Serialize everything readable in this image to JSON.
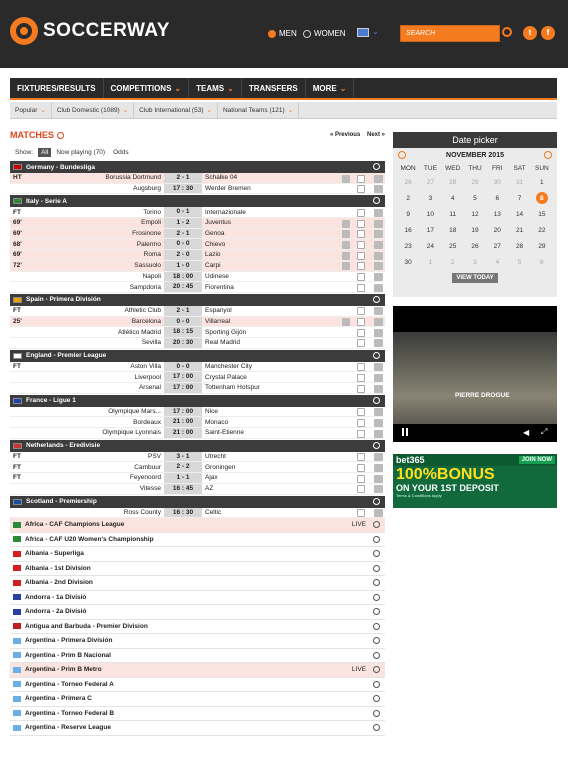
{
  "header": {
    "logo_text": "SOCCERWAY",
    "gender_men": "MEN",
    "gender_women": "WOMEN",
    "search_placeholder": "SEARCH",
    "social": [
      "t",
      "f"
    ]
  },
  "nav": {
    "items": [
      "FIXTURES/RESULTS",
      "COMPETITIONS",
      "TEAMS",
      "TRANSFERS",
      "MORE"
    ]
  },
  "subnav": {
    "items": [
      "Popular",
      "Club Domestic (1089)",
      "Club International (53)",
      "National Teams (121)"
    ]
  },
  "matches": {
    "title": "MATCHES",
    "prev": "« Previous",
    "next": "Next »",
    "show_label": "Show:",
    "filter_all": "All",
    "filter_live": "Now playing (70)",
    "filter_odds": "Odds"
  },
  "competitions": [
    {
      "name": "Germany - Bundesliga",
      "flag_color": "#c00",
      "rows": [
        {
          "status": "HT",
          "home": "Borussia Dortmund",
          "score": "2 - 1",
          "away": "Schalke 04",
          "live": true
        },
        {
          "status": "",
          "home": "Augsburg",
          "score": "17 : 30",
          "away": "Werder Bremen",
          "live": false
        }
      ]
    },
    {
      "name": "Italy - Serie A",
      "flag_color": "#2a8a3a",
      "rows": [
        {
          "status": "FT",
          "home": "Torino",
          "score": "0 - 1",
          "away": "Internazionale",
          "live": false
        },
        {
          "status": "69'",
          "home": "Empoli",
          "score": "1 - 2",
          "away": "Juventus",
          "live": true
        },
        {
          "status": "69'",
          "home": "Frosinone",
          "score": "2 - 1",
          "away": "Genoa",
          "live": true
        },
        {
          "status": "68'",
          "home": "Palermo",
          "score": "0 - 0",
          "away": "Chievo",
          "live": true
        },
        {
          "status": "69'",
          "home": "Roma",
          "score": "2 - 0",
          "away": "Lazio",
          "live": true
        },
        {
          "status": "72'",
          "home": "Sassuolo",
          "score": "1 - 0",
          "away": "Carpi",
          "live": true
        },
        {
          "status": "",
          "home": "Napoli",
          "score": "18 : 00",
          "away": "Udinese",
          "live": false
        },
        {
          "status": "",
          "home": "Sampdoria",
          "score": "20 : 45",
          "away": "Fiorentina",
          "live": false
        }
      ]
    },
    {
      "name": "Spain - Primera División",
      "flag_color": "#e8a000",
      "rows": [
        {
          "status": "FT",
          "home": "Athletic Club",
          "score": "2 - 1",
          "away": "Espanyol",
          "live": false
        },
        {
          "status": "25'",
          "home": "Barcelona",
          "score": "0 - 0",
          "away": "Villarreal",
          "live": true
        },
        {
          "status": "",
          "home": "Atlético Madrid",
          "score": "18 : 15",
          "away": "Sporting Gijón",
          "live": false
        },
        {
          "status": "",
          "home": "Sevilla",
          "score": "20 : 30",
          "away": "Real Madrid",
          "live": false
        }
      ]
    },
    {
      "name": "England - Premier League",
      "flag_color": "#fff",
      "rows": [
        {
          "status": "FT",
          "home": "Aston Villa",
          "score": "0 - 0",
          "away": "Manchester City",
          "live": false
        },
        {
          "status": "",
          "home": "Liverpool",
          "score": "17 : 00",
          "away": "Crystal Palace",
          "live": false
        },
        {
          "status": "",
          "home": "Arsenal",
          "score": "17 : 00",
          "away": "Tottenham Hotspur",
          "live": false
        }
      ]
    },
    {
      "name": "France - Ligue 1",
      "flag_color": "#2244aa",
      "rows": [
        {
          "status": "",
          "home": "Olympique Mars...",
          "score": "17 : 00",
          "away": "Nice",
          "live": false
        },
        {
          "status": "",
          "home": "Bordeaux",
          "score": "21 : 00",
          "away": "Monaco",
          "live": false
        },
        {
          "status": "",
          "home": "Olympique Lyonnais",
          "score": "21 : 00",
          "away": "Saint-Étienne",
          "live": false
        }
      ]
    },
    {
      "name": "Netherlands - Eredivisie",
      "flag_color": "#c33",
      "rows": [
        {
          "status": "FT",
          "home": "PSV",
          "score": "3 - 1",
          "away": "Utrecht",
          "live": false
        },
        {
          "status": "FT",
          "home": "Cambuur",
          "score": "2 - 2",
          "away": "Groningen",
          "live": false
        },
        {
          "status": "FT",
          "home": "Feyenoord",
          "score": "1 - 1",
          "away": "Ajax",
          "live": false
        },
        {
          "status": "",
          "home": "Vitesse",
          "score": "16 : 45",
          "away": "AZ",
          "live": false
        }
      ]
    },
    {
      "name": "Scotland - Premiership",
      "flag_color": "#1a4fa0",
      "rows": [
        {
          "status": "",
          "home": "Ross County",
          "score": "16 : 30",
          "away": "Celtic",
          "live": false
        }
      ]
    }
  ],
  "leagues": [
    {
      "name": "Africa - CAF Champions League",
      "live": "LIVE",
      "flag_color": "#2a8a3a"
    },
    {
      "name": "Africa - CAF U20 Women's Championship",
      "live": "",
      "flag_color": "#2a8a3a"
    },
    {
      "name": "Albania - Superliga",
      "live": "",
      "flag_color": "#d02020"
    },
    {
      "name": "Albania - 1st Division",
      "live": "",
      "flag_color": "#d02020"
    },
    {
      "name": "Albania - 2nd Division",
      "live": "",
      "flag_color": "#d02020"
    },
    {
      "name": "Andorra - 1a Divisió",
      "live": "",
      "flag_color": "#2a3fa0"
    },
    {
      "name": "Andorra - 2a Divisió",
      "live": "",
      "flag_color": "#2a3fa0"
    },
    {
      "name": "Antigua and Barbuda - Premier Division",
      "live": "",
      "flag_color": "#c02020"
    },
    {
      "name": "Argentina - Primera División",
      "live": "",
      "flag_color": "#6ab0e8"
    },
    {
      "name": "Argentina - Prim B Nacional",
      "live": "",
      "flag_color": "#6ab0e8"
    },
    {
      "name": "Argentina - Prim B Metro",
      "live": "LIVE",
      "flag_color": "#6ab0e8"
    },
    {
      "name": "Argentina - Torneo Federal A",
      "live": "",
      "flag_color": "#6ab0e8"
    },
    {
      "name": "Argentina - Primera C",
      "live": "",
      "flag_color": "#6ab0e8"
    },
    {
      "name": "Argentina - Torneo Federal B",
      "live": "",
      "flag_color": "#6ab0e8"
    },
    {
      "name": "Argentina - Reserve League",
      "live": "",
      "flag_color": "#6ab0e8"
    }
  ],
  "datepicker": {
    "title": "Date picker",
    "month": "NOVEMBER 2015",
    "weekdays": [
      "MON",
      "TUE",
      "WED",
      "THU",
      "FRI",
      "SAT",
      "SUN"
    ],
    "days": [
      [
        "26",
        "m"
      ],
      [
        "27",
        "m"
      ],
      [
        "28",
        "m"
      ],
      [
        "29",
        "m"
      ],
      [
        "30",
        "m"
      ],
      [
        "31",
        "m"
      ],
      [
        "1",
        ""
      ],
      [
        "2",
        ""
      ],
      [
        "3",
        ""
      ],
      [
        "4",
        ""
      ],
      [
        "5",
        ""
      ],
      [
        "6",
        ""
      ],
      [
        "7",
        ""
      ],
      [
        "8",
        "s"
      ],
      [
        "9",
        ""
      ],
      [
        "10",
        ""
      ],
      [
        "11",
        ""
      ],
      [
        "12",
        ""
      ],
      [
        "13",
        ""
      ],
      [
        "14",
        ""
      ],
      [
        "15",
        ""
      ],
      [
        "16",
        ""
      ],
      [
        "17",
        ""
      ],
      [
        "18",
        ""
      ],
      [
        "19",
        ""
      ],
      [
        "20",
        ""
      ],
      [
        "21",
        ""
      ],
      [
        "22",
        ""
      ],
      [
        "23",
        ""
      ],
      [
        "24",
        ""
      ],
      [
        "25",
        ""
      ],
      [
        "26",
        ""
      ],
      [
        "27",
        ""
      ],
      [
        "28",
        ""
      ],
      [
        "29",
        ""
      ],
      [
        "30",
        ""
      ],
      [
        "1",
        "m"
      ],
      [
        "2",
        "m"
      ],
      [
        "3",
        "m"
      ],
      [
        "4",
        "m"
      ],
      [
        "5",
        "m"
      ],
      [
        "6",
        "m"
      ]
    ],
    "today_label": "VIEW TODAY"
  },
  "video": {
    "caption": "PIERRE DROGUE"
  },
  "ad": {
    "brand": "bet365",
    "join": "JOIN NOW",
    "headline": "100%BONUS",
    "sub": "ON YOUR 1ST DEPOSIT",
    "fine": "Terms & Conditions Apply"
  }
}
